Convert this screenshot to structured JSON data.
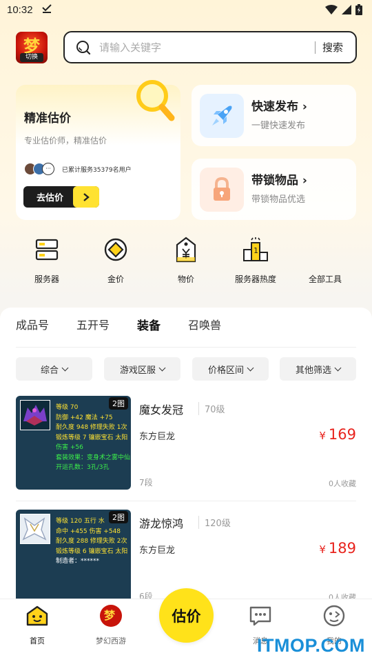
{
  "status_bar": {
    "time": "10:32"
  },
  "header": {
    "logo_badge": "切换",
    "search_placeholder": "请输入关键字",
    "search_button": "搜索"
  },
  "cards": {
    "main": {
      "title": "精准估价",
      "subtitle": "专业估价师，精准估价",
      "served_text": "已累计服务35379名用户",
      "button": "去估价"
    },
    "quick_publish": {
      "title": "快速发布",
      "subtitle": "一键快速发布"
    },
    "locked_items": {
      "title": "带锁物品",
      "subtitle": "带锁物品优选"
    }
  },
  "tools": [
    {
      "label": "服务器",
      "icon": "server-icon"
    },
    {
      "label": "金价",
      "icon": "gold-price-icon"
    },
    {
      "label": "物价",
      "icon": "price-tag-icon"
    },
    {
      "label": "服务器热度",
      "icon": "podium-icon"
    },
    {
      "label": "全部工具",
      "icon": "all-tools-icon"
    }
  ],
  "tabs": [
    {
      "label": "成品号",
      "active": false
    },
    {
      "label": "五开号",
      "active": false
    },
    {
      "label": "装备",
      "active": true
    },
    {
      "label": "召唤兽",
      "active": false
    }
  ],
  "filters": [
    "综合",
    "游戏区服",
    "价格区间",
    "其他筛选"
  ],
  "items": [
    {
      "name": "魔女发冠",
      "level": "70级",
      "server": "东方巨龙",
      "currency": "¥",
      "price": "169",
      "tier": "7段",
      "favorites": "0人收藏",
      "image_count": "2图",
      "thumb_lines": [
        {
          "text": "等级 70",
          "color": "#ffe232"
        },
        {
          "text": "防御 +42 魔法 +75",
          "color": "#ffe232"
        },
        {
          "text": "耐久度 948  修理失败 1次",
          "color": "#ffe232"
        },
        {
          "text": "锻炼等级 7  镶嵌宝石 太阳",
          "color": "#ffe232"
        },
        {
          "text": "伤害 +56",
          "color": "#3cf04a"
        },
        {
          "text": "套装效果：变身术之雾中仙",
          "color": "#3cf04a"
        },
        {
          "text": "开运孔数：3孔/3孔",
          "color": "#3cf04a"
        }
      ]
    },
    {
      "name": "游龙惊鸿",
      "level": "120级",
      "server": "东方巨龙",
      "currency": "¥",
      "price": "189",
      "tier": "6段",
      "favorites": "0人收藏",
      "image_count": "2图",
      "thumb_lines": [
        {
          "text": "等级 120  五行 水",
          "color": "#ffe232"
        },
        {
          "text": "命中 +455 伤害 +548",
          "color": "#ffe232"
        },
        {
          "text": "耐久度 288  修理失败 2次",
          "color": "#ffe232"
        },
        {
          "text": "锻炼等级 6  镶嵌宝石 太阳",
          "color": "#ffe232"
        },
        {
          "text": "制造者：******",
          "color": "#ffffff"
        }
      ]
    }
  ],
  "bottom_nav": {
    "home": "首页",
    "game": "梦幻西游",
    "estimate": "估价",
    "messages": "消息",
    "mine": "我的"
  },
  "watermark": "ITMOP.COM",
  "colors": {
    "accent": "#ffe232",
    "price": "#e8231d",
    "dark": "#1d1d1d"
  }
}
